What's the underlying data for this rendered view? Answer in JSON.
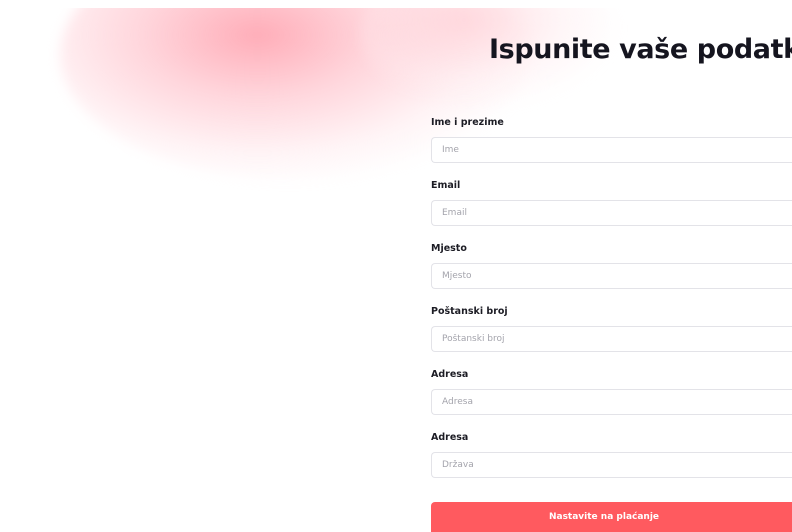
{
  "page": {
    "title": "Ispunite vaše podatke"
  },
  "form": {
    "fields": [
      {
        "label": "Ime i prezime",
        "placeholder": "Ime",
        "value": ""
      },
      {
        "label": "Email",
        "placeholder": "Email",
        "value": ""
      },
      {
        "label": "Mjesto",
        "placeholder": "Mjesto",
        "value": ""
      },
      {
        "label": "Poštanski broj",
        "placeholder": "Poštanski broj",
        "value": ""
      },
      {
        "label": "Adresa",
        "placeholder": "Adresa",
        "value": ""
      },
      {
        "label": "Adresa",
        "placeholder": "Država",
        "value": ""
      }
    ],
    "submit_label": "Nastavite na plaćanje"
  },
  "colors": {
    "accent": "#ff5a5f",
    "background_blob": "#ffb3bd",
    "text": "#15151f",
    "input_border": "#e3e3e8",
    "placeholder": "#a4a4ac"
  }
}
